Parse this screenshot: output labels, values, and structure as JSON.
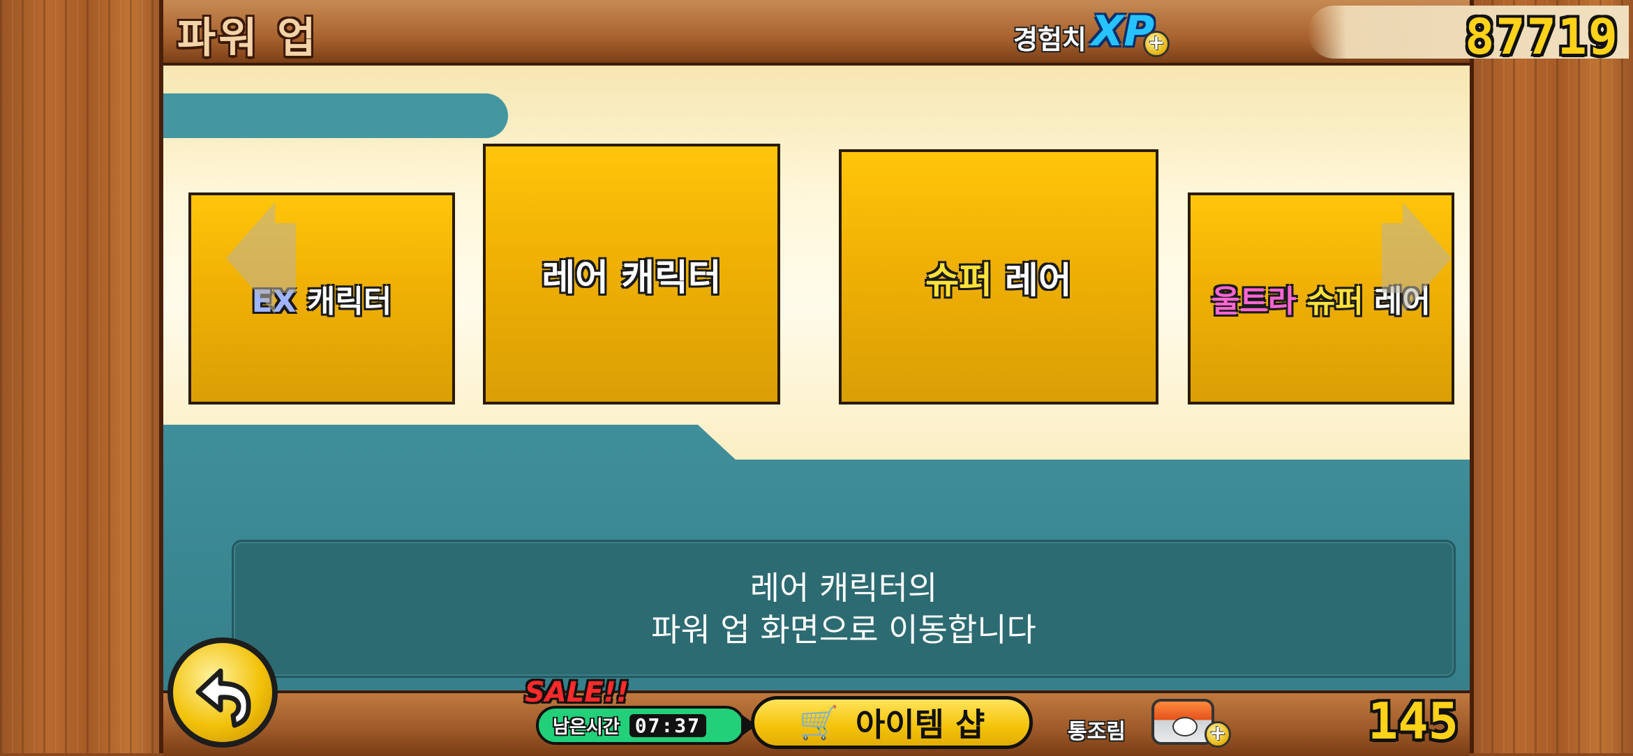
{
  "header": {
    "title": "파워 업",
    "xp_label": "경험치",
    "xp_logo": "XP",
    "xp_plus": "+",
    "xp_value": "87719"
  },
  "carousel": {
    "cards": [
      {
        "prefix": "EX",
        "label": " 캐릭터"
      },
      {
        "label": "레어 캐릭터"
      },
      {
        "prefix": "슈퍼",
        "label": " 레어"
      },
      {
        "prefix_pink": "울트라",
        "prefix_yellow": " 슈퍼",
        "label": " 레어"
      }
    ]
  },
  "description": {
    "line1": "레어 캐릭터의",
    "line2": "파워 업 화면으로 이동합니다"
  },
  "footer": {
    "back_icon": "back-arrow-icon",
    "sale_text": "SALE!!",
    "timer_label": "남은시간",
    "timer_value": "07:37",
    "shop_label": "아이템 샵",
    "catfood_label": "통조림",
    "catfood_plus": "+",
    "catfood_value": "145"
  },
  "colors": {
    "card_gold": "#f0b004",
    "teal": "#357f8a",
    "xp_blue": "#26c3ff",
    "value_yellow": "#ffd21a",
    "sale_red": "#ff2a2a",
    "timer_green": "#22d07a"
  }
}
